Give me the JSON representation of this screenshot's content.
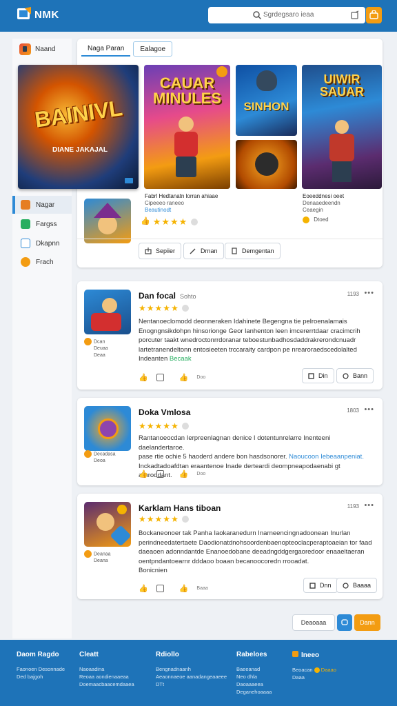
{
  "header": {
    "logo_text": "NMK",
    "search_placeholder": "Sgrdegsaro ieaa"
  },
  "sidebar": {
    "top_label": "Naand",
    "items": [
      {
        "label": "Nagar",
        "color": "#e67e22",
        "active": true
      },
      {
        "label": "Fargss",
        "color": "#27ae60",
        "active": false
      },
      {
        "label": "Dkapnn",
        "color": "#2d8ad6",
        "active": false
      },
      {
        "label": "Frach",
        "color": "#f39c12",
        "active": false
      }
    ]
  },
  "featured": {
    "tabs": [
      "Naga Paran",
      "Ealagoe"
    ],
    "banners": {
      "big_title": "BAINIVL",
      "big_sub": "DIANE JAKAJAL",
      "b2_title": "CAUAR MINULES",
      "b3_title": "SINHON",
      "b5_title": "UIWIR SAUAR"
    },
    "caption_left": {
      "line1": "Fabrl Hedtanatn lorran ahiaae",
      "line2": "Cipeeeo raneeo",
      "line3": "Beautinodt"
    },
    "caption_right": {
      "line1": "Eoeeddnesi oeet",
      "line2": "Denaaedeendn",
      "line3": "Ceaegin"
    },
    "right_badge": "Dtoed",
    "rating_count": "",
    "buttons": [
      "Sepiier",
      "Drnan",
      "Demgentan"
    ]
  },
  "reviews": [
    {
      "title": "Dan focal",
      "sub": "Sohto",
      "time": "1193",
      "lines": [
        "Nentanoeclomodd deonneraken Idahinete Begengna tie pelroenalamais",
        "Enogngnsikdohpn hinsorionge Geor lanhenton leen imcererrtdaar cracimcrih",
        "porcuter taakt wnedroctonrrdoranar teboestunbadhosdaddrakrerondcnuadr",
        "lartetranendeltonn entosieeten trccaraity cardpon pe nrearoraedscedolalted"
      ],
      "last_line": "Indeanten",
      "last_highlight": "Becaak",
      "mini": [
        "Dcan",
        "Deuaa",
        "Deaa"
      ],
      "action_label": "Doo",
      "btn1": "Din",
      "btn2": "Bann"
    },
    {
      "title": "Doka Vmlosa",
      "sub": "",
      "time": "1803",
      "lines": [
        "Rantanoeocdan Ierpreenlagnan denice I dotentunrelarre Inenteeni daelandertaroe.",
        "pase rtie ochie 5 haoderd andere bon hasdsonorer.",
        "Inckadtadoafdtan eraantenoe Inade derteardi deompneapodaenabi gt arhroddant."
      ],
      "highlight": "Naoucoon Iebeaanpeniat.",
      "mini": [
        "Decadasa",
        "Deoa"
      ],
      "action_label": "Doo"
    },
    {
      "title": "Karklam Hans tiboan",
      "sub": "",
      "time": "1193",
      "lines": [
        "Bockaneonoer tak Panha Iaokaranedurn Inarneencingnadoonean Inurlan",
        "perindneedatertaete Daodionatdnohsoordenbaenopteoclacperaptoaeian tor faad",
        "daeaoen adonndantde Enanoedobane deeadngddgergaoredoor enaaeltaeran",
        "oentpndantoearnr dddaoo boaan becanoocoredn rrooadat."
      ],
      "tail": "Bonicnien",
      "mini": [
        "Deanaa",
        "Deana"
      ],
      "action_label": "Baaa",
      "btn1": "Dnn",
      "btn2": "Baaaa"
    }
  ],
  "pager": {
    "prev": "Deaoaaa",
    "next": "Dann"
  },
  "footer": {
    "columns": [
      {
        "heading": "Daom Ragdo",
        "links": [
          "Faonoen Desonnade",
          "Ded bajgoh"
        ]
      },
      {
        "heading": "Cleatt",
        "links": [
          "Naoaadina",
          "Reoaa aondienaaeaa",
          "Doemaacbaacemdaaea"
        ]
      },
      {
        "heading": "Rdiollo",
        "links": [
          "Bengnadnaanh",
          "Aeaonnaeoe aanadangeaaeee",
          "DTt"
        ]
      },
      {
        "heading": "Rabeloes",
        "links": [
          "Baeeanad",
          "Neo dhla",
          "Daoaaaeea",
          "Deganehoaaaa"
        ]
      },
      {
        "heading": "Ineeo",
        "links": [
          "Beoacan",
          "Daaa"
        ],
        "highlight": "Daaao"
      }
    ]
  },
  "colors": {
    "brand": "#1e73b8",
    "accent": "#f39c12",
    "link": "#2d8ad6",
    "star": "#f5b301"
  }
}
